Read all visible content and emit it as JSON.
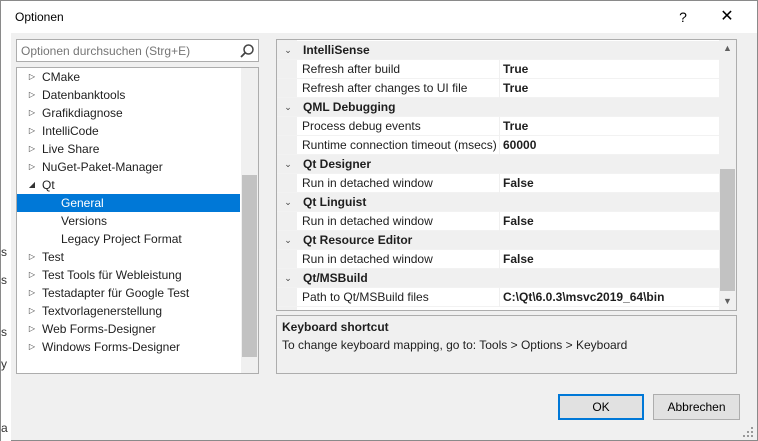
{
  "window": {
    "title": "Optionen",
    "help_glyph": "?",
    "close_glyph": "✕"
  },
  "search": {
    "placeholder": "Optionen durchsuchen (Strg+E)"
  },
  "tree": {
    "items": [
      {
        "label": "CMake",
        "level": 0,
        "expanded": false
      },
      {
        "label": "Datenbanktools",
        "level": 0,
        "expanded": false
      },
      {
        "label": "Grafikdiagnose",
        "level": 0,
        "expanded": false
      },
      {
        "label": "IntelliCode",
        "level": 0,
        "expanded": false
      },
      {
        "label": "Live Share",
        "level": 0,
        "expanded": false
      },
      {
        "label": "NuGet-Paket-Manager",
        "level": 0,
        "expanded": false
      },
      {
        "label": "Qt",
        "level": 0,
        "expanded": true
      },
      {
        "label": "General",
        "level": 1,
        "selected": true
      },
      {
        "label": "Versions",
        "level": 1
      },
      {
        "label": "Legacy Project Format",
        "level": 1
      },
      {
        "label": "Test",
        "level": 0,
        "expanded": false
      },
      {
        "label": "Test Tools für Webleistung",
        "level": 0,
        "expanded": false
      },
      {
        "label": "Testadapter für Google Test",
        "level": 0,
        "expanded": false
      },
      {
        "label": "Textvorlagenerstellung",
        "level": 0,
        "expanded": false
      },
      {
        "label": "Web Forms-Designer",
        "level": 0,
        "expanded": false
      },
      {
        "label": "Windows Forms-Designer",
        "level": 0,
        "expanded": false
      }
    ]
  },
  "grid": {
    "rows": [
      {
        "type": "category",
        "name": "IntelliSense"
      },
      {
        "type": "property",
        "name": "Refresh after build",
        "value": "True"
      },
      {
        "type": "property",
        "name": "Refresh after changes to UI file",
        "value": "True"
      },
      {
        "type": "category",
        "name": "QML Debugging"
      },
      {
        "type": "property",
        "name": "Process debug events",
        "value": "True"
      },
      {
        "type": "property",
        "name": "Runtime connection timeout (msecs)",
        "value": "60000"
      },
      {
        "type": "category",
        "name": "Qt Designer"
      },
      {
        "type": "property",
        "name": "Run in detached window",
        "value": "False"
      },
      {
        "type": "category",
        "name": "Qt Linguist"
      },
      {
        "type": "property",
        "name": "Run in detached window",
        "value": "False"
      },
      {
        "type": "category",
        "name": "Qt Resource Editor"
      },
      {
        "type": "property",
        "name": "Run in detached window",
        "value": "False"
      },
      {
        "type": "category",
        "name": "Qt/MSBuild"
      },
      {
        "type": "property",
        "name": "Path to Qt/MSBuild files",
        "value": "C:\\Qt\\6.0.3\\msvc2019_64\\bin"
      }
    ]
  },
  "description": {
    "title": "Keyboard shortcut",
    "text": "To change keyboard mapping, go to: Tools > Options > Keyboard"
  },
  "buttons": {
    "ok": "OK",
    "cancel": "Abbrechen"
  },
  "background": {
    "glyphs": [
      "s",
      "s",
      "s",
      "y",
      "a"
    ]
  }
}
